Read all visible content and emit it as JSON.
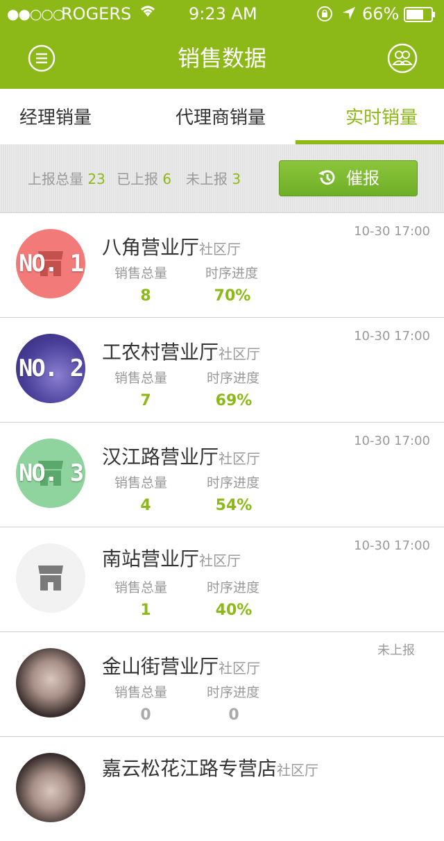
{
  "status_bar": {
    "signal": "●●○○○",
    "carrier": "ROGERS",
    "time": "9:23 AM",
    "battery": "66%"
  },
  "header": {
    "title": "销售数据",
    "menu_icon": "menu-icon",
    "contacts_icon": "contacts-icon"
  },
  "tabs": [
    {
      "label": "经理销量",
      "active": false
    },
    {
      "label": "代理商销量",
      "active": false
    },
    {
      "label": "实时销量",
      "active": true
    }
  ],
  "summary": {
    "total_label": "上报总量",
    "total_value": "23",
    "reported_label": "已上报",
    "reported_value": "6",
    "unreported_label": "未上报",
    "unreported_value": "3",
    "remind_label": "催报"
  },
  "list_labels": {
    "sales_total": "销售总量",
    "progress": "时序进度",
    "type": "社区厅"
  },
  "stores": [
    {
      "rank": "NO. 1",
      "name": "八角营业厅",
      "type": "社区厅",
      "time": "10-30 17:00",
      "sales": "8",
      "progress": "70%",
      "avatar": "rank-red"
    },
    {
      "rank": "NO. 2",
      "name": "工农村营业厅",
      "type": "社区厅",
      "time": "10-30 17:00",
      "sales": "7",
      "progress": "69%",
      "avatar": "rank-purple-photo"
    },
    {
      "rank": "NO. 3",
      "name": "汉江路营业厅",
      "type": "社区厅",
      "time": "10-30 17:00",
      "sales": "4",
      "progress": "54%",
      "avatar": "rank-green"
    },
    {
      "rank": "",
      "name": "南站营业厅",
      "type": "社区厅",
      "time": "10-30 17:00",
      "sales": "1",
      "progress": "40%",
      "avatar": "store-grey"
    },
    {
      "rank": "",
      "name": "金山街营业厅",
      "type": "社区厅",
      "time": "未上报",
      "sales": "0",
      "progress": "0",
      "avatar": "photo"
    },
    {
      "rank": "",
      "name": "嘉云松花江路专营店",
      "type": "社区厅",
      "time": "",
      "sales": "",
      "progress": "",
      "avatar": "photo"
    }
  ],
  "colors": {
    "brand": "#8cb918",
    "rank1": "#f27a78",
    "rank2": "#4a3f9a",
    "rank3": "#8fd39e"
  }
}
